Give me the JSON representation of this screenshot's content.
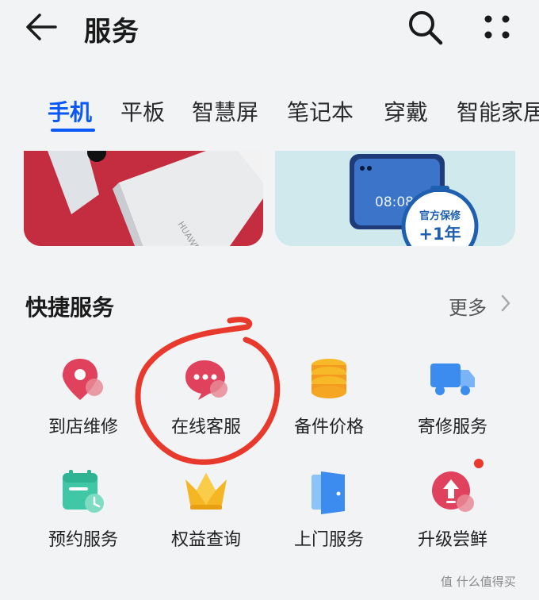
{
  "header": {
    "title": "服务"
  },
  "tabs": [
    {
      "label": "手机",
      "active": true
    },
    {
      "label": "平板"
    },
    {
      "label": "智慧屏"
    },
    {
      "label": "笔记本"
    },
    {
      "label": "穿戴"
    },
    {
      "label": "智能家居"
    }
  ],
  "banners": {
    "left": {
      "brand_text": "HUAWEI"
    },
    "right": {
      "time_text": "08:08",
      "badge_line1": "官方保修",
      "badge_line2": "+1年"
    }
  },
  "quick_services": {
    "title": "快捷服务",
    "more_label": "更多",
    "items": [
      {
        "label": "到店维修",
        "icon": "location-pin-icon"
      },
      {
        "label": "在线客服",
        "icon": "chat-bubble-icon"
      },
      {
        "label": "备件价格",
        "icon": "coin-stack-icon"
      },
      {
        "label": "寄修服务",
        "icon": "delivery-truck-icon"
      },
      {
        "label": "预约服务",
        "icon": "calendar-clock-icon"
      },
      {
        "label": "权益查询",
        "icon": "crown-icon"
      },
      {
        "label": "上门服务",
        "icon": "door-icon"
      },
      {
        "label": "升级尝鲜",
        "icon": "upgrade-arrow-icon"
      }
    ]
  },
  "watermark": {
    "text": "值 什么值得买"
  },
  "colors": {
    "accent": "#0a59f7",
    "annotation_red": "#e83a2c",
    "service_red": "#e0415c"
  }
}
